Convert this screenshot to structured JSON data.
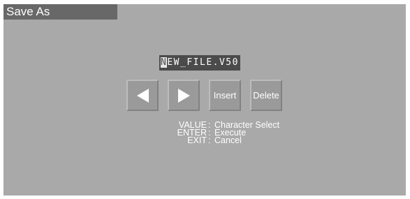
{
  "dialog": {
    "title": "Save As"
  },
  "filename": {
    "cursor_char": "N",
    "rest": "EW_FILE.V50"
  },
  "buttons": {
    "left_icon": "left-arrow-icon",
    "right_icon": "right-arrow-icon",
    "insert_label": "Insert",
    "delete_label": "Delete"
  },
  "help": [
    {
      "key": "VALUE",
      "sep": ":",
      "desc": "Character Select"
    },
    {
      "key": "ENTER",
      "sep": ":",
      "desc": "Execute"
    },
    {
      "key": "EXIT",
      "sep": ":",
      "desc": "Cancel"
    }
  ],
  "colors": {
    "screen_bg": "#a9a9a9",
    "title_bg": "#686868",
    "field_bg": "#4b4b4b",
    "button_bg": "#9a9a9a",
    "text": "#ffffff"
  }
}
